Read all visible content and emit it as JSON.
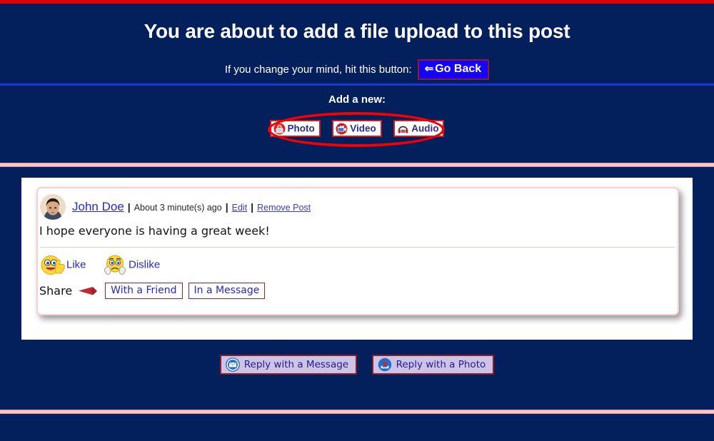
{
  "page": {
    "title": "You are about to add a file upload to this post",
    "go_back_prompt": "If you change your mind, hit this button:",
    "go_back_label": "Go Back",
    "go_back_arrow": "⇐",
    "add_new_heading": "Add a new:"
  },
  "media_buttons": [
    {
      "label": "Photo",
      "icon": "photo-icon"
    },
    {
      "label": "Video",
      "icon": "video-icon"
    },
    {
      "label": "Audio",
      "icon": "audio-headphones-icon"
    }
  ],
  "annotation": {
    "shape": "ellipse",
    "color": "#f40000"
  },
  "post": {
    "author": "John Doe",
    "separator": "|",
    "timestamp": "About 3 minute(s) ago",
    "edit_label": "Edit",
    "remove_label": "Remove Post",
    "body": "I hope everyone is having a great week!",
    "reactions": [
      {
        "label": "Like",
        "icon": "thumbs-up-smiley-icon"
      },
      {
        "label": "Dislike",
        "icon": "thumbs-down-frowny-icon"
      }
    ],
    "share": {
      "label": "Share",
      "arrow_icon": "red-arrow-icon",
      "buttons": [
        {
          "label": "With a Friend"
        },
        {
          "label": "In a Message"
        }
      ]
    }
  },
  "reply_buttons": [
    {
      "label": "Reply with a Message",
      "icon": "envelope-icon"
    },
    {
      "label": "Reply with a Photo",
      "icon": "upload-photo-icon"
    }
  ],
  "colors": {
    "page_background": "#04205c",
    "top_bar": "#e30000",
    "divider_blue": "#1b35d8",
    "divider_pink": "#f9c6c6",
    "accent_red": "#c21f28",
    "link_blue": "#2727d6",
    "button_blue": "#1500ff",
    "reply_button_fill": "#ccc3e6"
  }
}
